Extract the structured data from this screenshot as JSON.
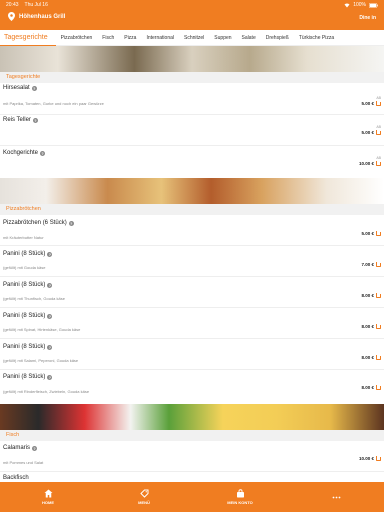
{
  "status": {
    "time": "20:43",
    "date": "Thu Jul 16",
    "battery": "100%"
  },
  "header": {
    "restaurant": "Höhenhaus Grill",
    "mode": "Dine in",
    "accent": "#f07d21"
  },
  "tabs": [
    "Tagesgerichte",
    "Pizzabrötchen",
    "Fisch",
    "Pizza",
    "International",
    "Schnitzel",
    "Suppen",
    "Salate",
    "Drehspieß",
    "Türkische Pizza"
  ],
  "sections": [
    {
      "title": "Tagesgerichte",
      "items": [
        {
          "name": "Hirsesalat",
          "desc": "mit Paprika, Tomaten, Gurke und noch ein paar Gewürze",
          "ab": "AB",
          "price": "5.00 €"
        },
        {
          "name": "Reis Teller",
          "desc": "",
          "ab": "AB",
          "price": "5.00 €"
        },
        {
          "name": "Kochgerichte",
          "desc": "",
          "ab": "AB",
          "price": "10.00 €"
        }
      ]
    },
    {
      "title": "Pizzabrötchen",
      "items": [
        {
          "name": "Pizzabrötchen (6 Stück)",
          "desc": "mit Kräuterbutter Natur",
          "price": "5.00 €"
        },
        {
          "name": "Panini (8 Stück)",
          "desc": "(gefüllt) mit Gouda käse",
          "price": "7.00 €"
        },
        {
          "name": "Panini (8 Stück)",
          "desc": "(gefüllt) mit Thunfisch, Gouda käse",
          "price": "8.00 €"
        },
        {
          "name": "Panini (8 Stück)",
          "desc": "(gefüllt) mit Spinat, Hirtenkäse, Gouda käse",
          "price": "8.00 €"
        },
        {
          "name": "Panini (8 Stück)",
          "desc": "(gefüllt) mit Salami, Peperoni, Gouda käse",
          "price": "8.00 €"
        },
        {
          "name": "Panini (8 Stück)",
          "desc": "(gefüllt) mit Rinderfleisch, Zwiebeln, Gouda käse",
          "price": "8.00 €"
        }
      ]
    },
    {
      "title": "Fisch",
      "items": [
        {
          "name": "Calamaris",
          "desc": "mit Pommes und Salat",
          "price": "10.00 €"
        },
        {
          "name": "Backfisch",
          "desc": "",
          "price": ""
        }
      ]
    }
  ],
  "bottom_nav": [
    {
      "label": "HOME",
      "icon": "home-icon"
    },
    {
      "label": "MENÜ",
      "icon": "menu-tag-icon"
    },
    {
      "label": "MEIN KONTO",
      "icon": "account-bag-icon"
    },
    {
      "label": "",
      "icon": "more-icon"
    }
  ]
}
